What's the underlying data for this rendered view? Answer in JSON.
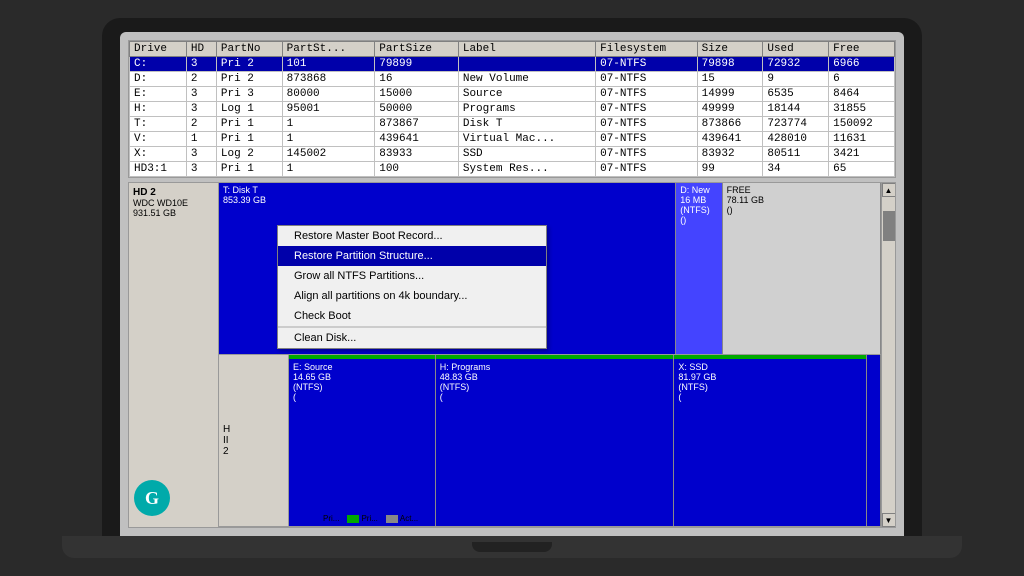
{
  "table": {
    "headers": [
      "Drive",
      "HD",
      "PartNo",
      "PartSt...",
      "PartSize",
      "Label",
      "Filesystem",
      "Size",
      "Used",
      "Free"
    ],
    "rows": [
      {
        "drive": "C:",
        "hd": "3",
        "partno": "Pri 2",
        "partst": "101",
        "partsize": "79899",
        "label": "",
        "filesystem": "07-NTFS",
        "size": "79898",
        "used": "72932",
        "free": "6966",
        "selected": true
      },
      {
        "drive": "D:",
        "hd": "2",
        "partno": "Pri 2",
        "partst": "873868",
        "partsize": "16",
        "label": "New Volume",
        "filesystem": "07-NTFS",
        "size": "15",
        "used": "9",
        "free": "6",
        "selected": false
      },
      {
        "drive": "E:",
        "hd": "3",
        "partno": "Pri 3",
        "partst": "80000",
        "partsize": "15000",
        "label": "Source",
        "filesystem": "07-NTFS",
        "size": "14999",
        "used": "6535",
        "free": "8464",
        "selected": false
      },
      {
        "drive": "H:",
        "hd": "3",
        "partno": "Log 1",
        "partst": "95001",
        "partsize": "50000",
        "label": "Programs",
        "filesystem": "07-NTFS",
        "size": "49999",
        "used": "18144",
        "free": "31855",
        "selected": false
      },
      {
        "drive": "T:",
        "hd": "2",
        "partno": "Pri 1",
        "partst": "1",
        "partsize": "873867",
        "label": "Disk T",
        "filesystem": "07-NTFS",
        "size": "873866",
        "used": "723774",
        "free": "150092",
        "selected": false
      },
      {
        "drive": "V:",
        "hd": "1",
        "partno": "Pri 1",
        "partst": "1",
        "partsize": "439641",
        "label": "Virtual Mac...",
        "filesystem": "07-NTFS",
        "size": "439641",
        "used": "428010",
        "free": "11631",
        "selected": false
      },
      {
        "drive": "X:",
        "hd": "3",
        "partno": "Log 2",
        "partst": "145002",
        "partsize": "83933",
        "label": "SSD",
        "filesystem": "07-NTFS",
        "size": "83932",
        "used": "80511",
        "free": "3421",
        "selected": false
      },
      {
        "drive": "HD3:1",
        "hd": "3",
        "partno": "Pri 1",
        "partst": "1",
        "partsize": "100",
        "label": "System Res...",
        "filesystem": "07-NTFS",
        "size": "99",
        "used": "34",
        "free": "65",
        "selected": false
      }
    ]
  },
  "disk": {
    "hd2": {
      "name": "HD 2",
      "model": "WDC WD10E",
      "size": "931.51 GB"
    },
    "hd_other": {
      "name": "H",
      "line2": "II",
      "line3": "2"
    },
    "partitions_row1": [
      {
        "label": "T: Disk T",
        "sub": "853.39 GB",
        "type": "blue-large"
      },
      {
        "label": "D: New",
        "sub": "16 MB\n(NTFS)\n()",
        "type": "blue-small"
      },
      {
        "label": "FREE",
        "sub": "78.11 GB\n()",
        "type": "free"
      }
    ],
    "partitions_row2": [
      {
        "label": "E: Source",
        "sub": "14.65 GB\n(NTFS)\n(",
        "type": "blue"
      },
      {
        "label": "H: Programs",
        "sub": "48.83 GB\n(NTFS)\n(",
        "type": "blue"
      },
      {
        "label": "X: SSD",
        "sub": "81.97 GB\n(NTFS)\n(",
        "type": "blue"
      }
    ]
  },
  "context_menu": {
    "items": [
      {
        "label": "Restore Master Boot Record...",
        "highlighted": false
      },
      {
        "label": "Restore Partition Structure...",
        "highlighted": true
      },
      {
        "label": "Grow all NTFS Partitions...",
        "highlighted": false
      },
      {
        "label": "Align all partitions on 4k boundary...",
        "highlighted": false
      },
      {
        "label": "Check Boot",
        "highlighted": false
      },
      {
        "label": "",
        "divider": true
      },
      {
        "label": "Clean Disk...",
        "highlighted": false
      }
    ]
  },
  "logo": {
    "letter": "G"
  },
  "legend": [
    {
      "color": "#0000cc",
      "label": "Pri..."
    },
    {
      "color": "#00aa00",
      "label": "Pri..."
    },
    {
      "color": "#888888",
      "label": "Act..."
    }
  ]
}
